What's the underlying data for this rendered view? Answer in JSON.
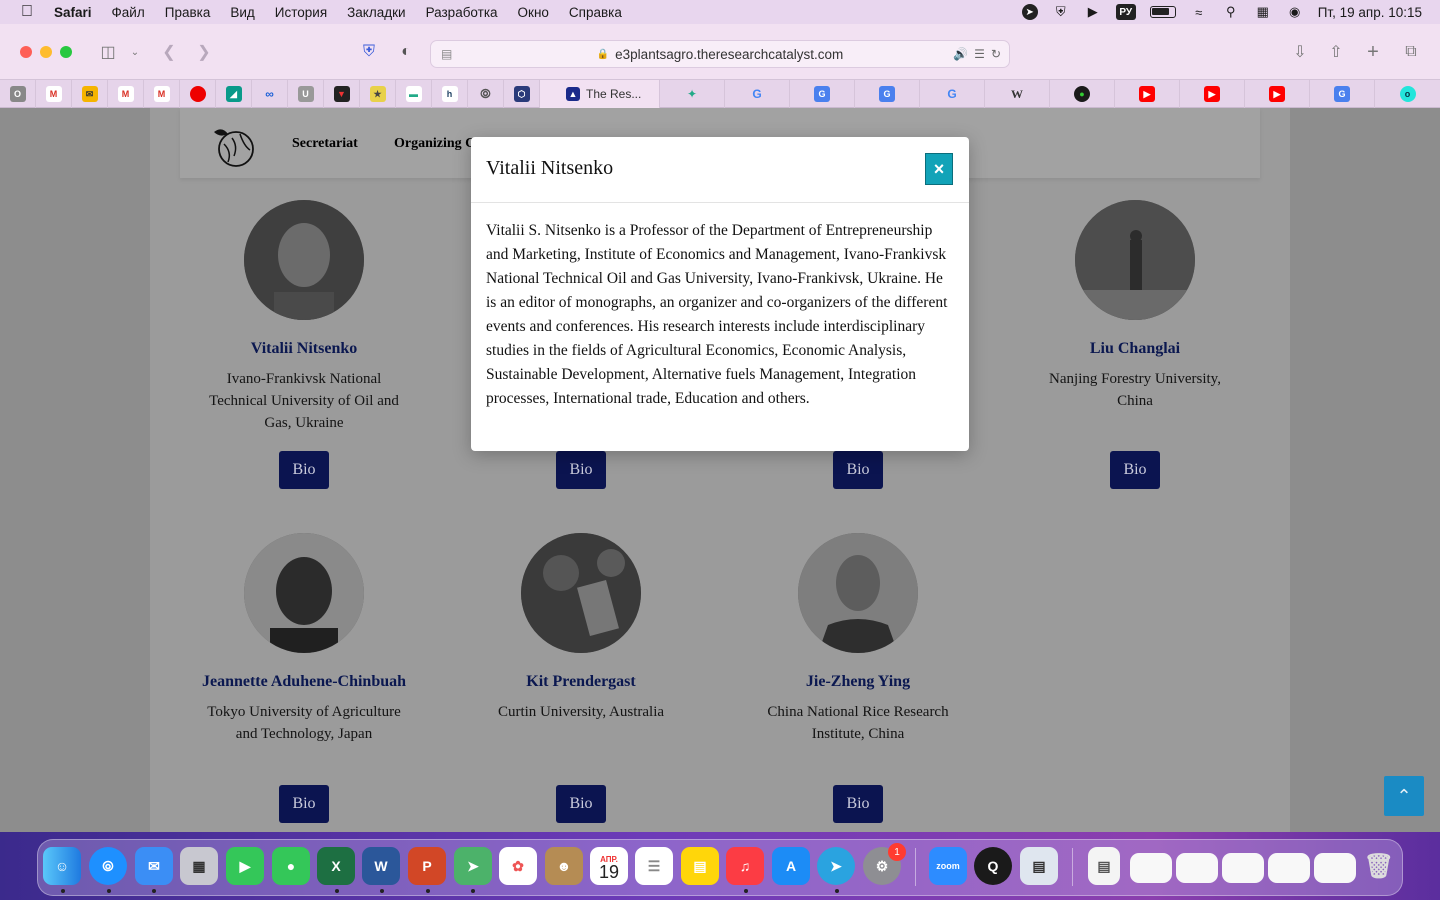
{
  "menubar": {
    "app_name": "Safari",
    "items": [
      "Файл",
      "Правка",
      "Вид",
      "История",
      "Закладки",
      "Разработка",
      "Окно",
      "Справка"
    ],
    "keyboard_layout": "РУ",
    "datetime": "Пт, 19 апр.  10:15"
  },
  "browser": {
    "url": "e3plantsagro.theresearchcatalyst.com",
    "active_tab_title": "The Res..."
  },
  "site_nav": {
    "items": [
      "Secretariat",
      "Organizing C"
    ]
  },
  "people": [
    {
      "name": "Vitalii Nitsenko",
      "affiliation": "Ivano-Frankivsk National Technical University of Oil and Gas, Ukraine",
      "button": "Bio"
    },
    {
      "name": "",
      "affiliation": "",
      "button": "Bio"
    },
    {
      "name": "",
      "affiliation": "",
      "button": "Bio"
    },
    {
      "name": "Liu Changlai",
      "affiliation": "Nanjing Forestry University, China",
      "button": "Bio"
    },
    {
      "name": "Jeannette Aduhene-Chinbuah",
      "affiliation": "Tokyo University of Agriculture and Technology, Japan",
      "button": "Bio"
    },
    {
      "name": "Kit Prendergast",
      "affiliation": "Curtin University, Australia",
      "button": "Bio"
    },
    {
      "name": "Jie-Zheng Ying",
      "affiliation": "China National Rice Research Institute, China",
      "button": "Bio"
    }
  ],
  "modal": {
    "title": "Vitalii Nitsenko",
    "close_label": "×",
    "body": "Vitalii S. Nitsenko is a Professor of the Department of Entrepreneurship and Marketing, Institute of Economics and Management, Ivano-Frankivsk National Technical Oil and Gas University, Ivano-Frankivsk, Ukraine. He is an editor of monographs, an organizer and co-organizers of the different events and conferences. His research interests include interdisciplinary studies in the fields of Agricultural Economics, Economic Analysis, Sustainable Development, Alternative fuels Management, Integration processes, International trade, Education and others."
  },
  "dock": {
    "calendar_month": "АПР.",
    "calendar_day": "19",
    "settings_badge": "1",
    "zoom_label": "zoom"
  },
  "colors": {
    "name_link": "#0b1850",
    "bio_button": "#0b1450",
    "close_button": "#12a3b8",
    "scroll_top": "#1a8bc4"
  }
}
